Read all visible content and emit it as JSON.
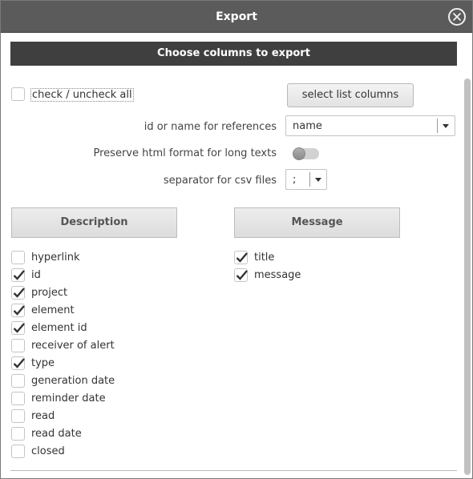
{
  "dialog": {
    "title": "Export",
    "section_title": "Choose columns to export",
    "check_all_label": "check / uncheck all",
    "select_list_columns_label": "select list columns",
    "ref_label": "id or name for references",
    "ref_value": "name",
    "preserve_label": "Preserve html format for long texts",
    "preserve_on": false,
    "separator_label": "separator for csv files",
    "separator_value": ";"
  },
  "groups": {
    "description": {
      "label": "Description",
      "items": [
        {
          "label": "hyperlink",
          "checked": false
        },
        {
          "label": "id",
          "checked": true
        },
        {
          "label": "project",
          "checked": true
        },
        {
          "label": "element",
          "checked": true
        },
        {
          "label": "element id",
          "checked": true
        },
        {
          "label": "receiver of alert",
          "checked": false
        },
        {
          "label": "type",
          "checked": true
        },
        {
          "label": "generation date",
          "checked": false
        },
        {
          "label": "reminder date",
          "checked": false
        },
        {
          "label": "read",
          "checked": false
        },
        {
          "label": "read date",
          "checked": false
        },
        {
          "label": "closed",
          "checked": false
        }
      ]
    },
    "message": {
      "label": "Message",
      "items": [
        {
          "label": "title",
          "checked": true
        },
        {
          "label": "message",
          "checked": true
        }
      ]
    }
  },
  "icons": {
    "close": "close-circle-icon",
    "check": "checkmark-icon",
    "dropdown": "chevron-down-icon"
  }
}
